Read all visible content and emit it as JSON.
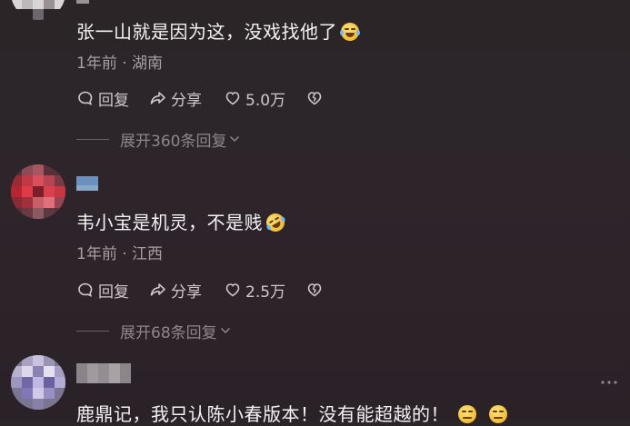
{
  "comments": [
    {
      "text": "张一山就是因为这，没戏找他了",
      "emoji": "laughing-with-tears-emoji",
      "time": "1年前",
      "sep": " · ",
      "location": "湖南",
      "reply_label": "回复",
      "share_label": "分享",
      "likes": "5.0万",
      "expand_label": "展开360条回复"
    },
    {
      "text": "韦小宝是机灵，不是贱",
      "emoji": "rolling-laughing-emoji",
      "time": "1年前",
      "sep": " · ",
      "location": "江西",
      "reply_label": "回复",
      "share_label": "分享",
      "likes": "2.5万",
      "expand_label": "展开68条回复"
    },
    {
      "text": "鹿鼎记，我只认陈小春版本！没有能超越的！",
      "emoji": "smirk-emoji"
    }
  ],
  "colors": {
    "background": "#2b2528",
    "text": "#f4f2f3",
    "meta": "#a59ea2",
    "muted": "#8d868a"
  }
}
